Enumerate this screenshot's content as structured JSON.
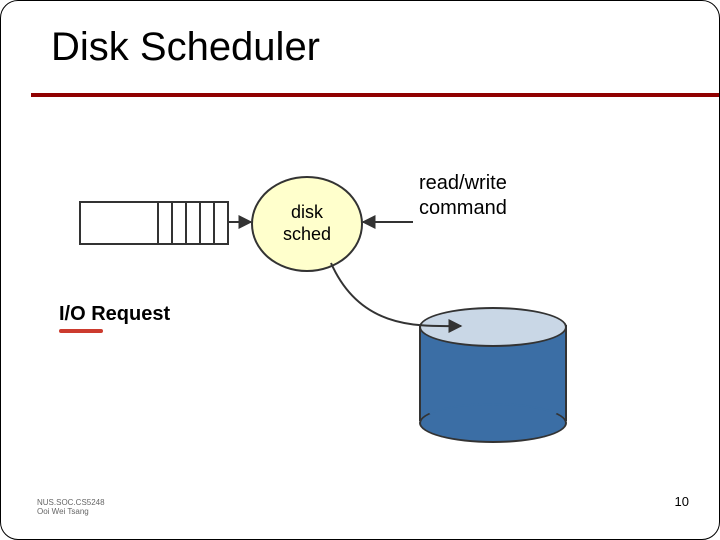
{
  "title": "Disk Scheduler",
  "sched_label": "disk\nsched",
  "rw_label": "read/write\ncommand",
  "io_label": "I/O Request",
  "page_number": "10",
  "credit_line1": "NUS.SOC.CS5248",
  "credit_line2": "Ooi Wei Tsang",
  "colors": {
    "rule": "#900000",
    "sched_fill": "#ffffcc",
    "disk_fill": "#3b6ea5",
    "disk_top": "#c9d7e6"
  }
}
